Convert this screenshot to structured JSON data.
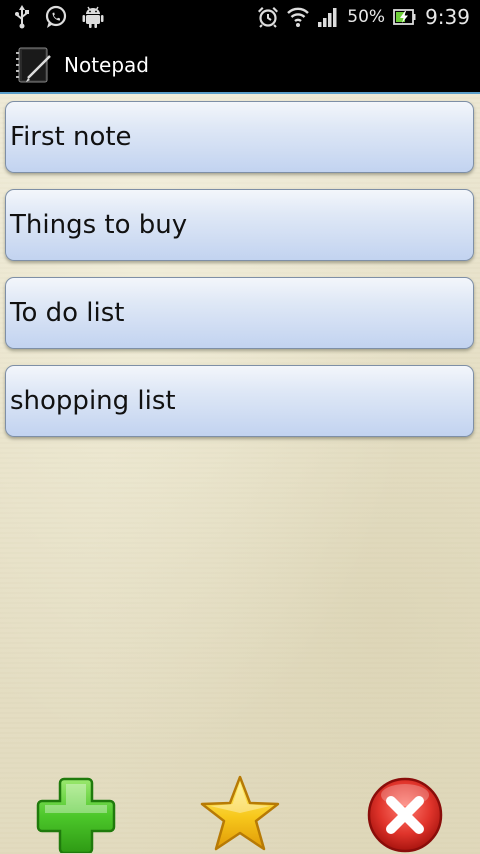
{
  "status_bar": {
    "battery_percent": "50%",
    "time": "9:39",
    "icons": [
      "usb-icon",
      "whatsapp-icon",
      "android-icon",
      "alarm-icon",
      "wifi-icon",
      "signal-icon",
      "battery-charging-icon"
    ]
  },
  "app": {
    "title": "Notepad",
    "accent_color": "#5b9ec9"
  },
  "notes": [
    {
      "label": "First note"
    },
    {
      "label": "Things to buy"
    },
    {
      "label": "To do list"
    },
    {
      "label": "shopping list"
    }
  ],
  "toolbar": {
    "buttons": [
      {
        "icon": "add-plus-icon",
        "color": "#3cbb22"
      },
      {
        "icon": "star-icon",
        "color": "#f5c518"
      },
      {
        "icon": "delete-x-icon",
        "color": "#d9302a"
      }
    ]
  }
}
